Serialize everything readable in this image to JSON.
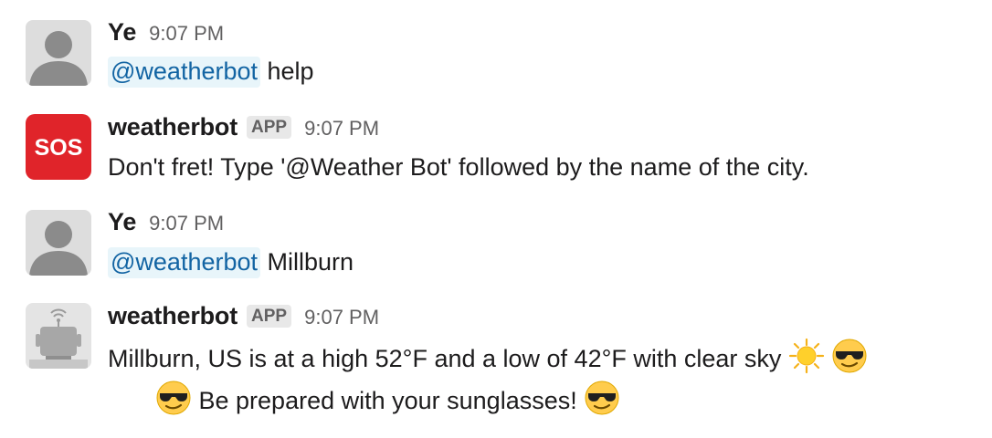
{
  "messages": [
    {
      "author": "Ye",
      "time": "9:07 PM",
      "mention": "@weatherbot",
      "text": " help",
      "avatar_icon": "user-silhouette-icon"
    },
    {
      "author": "weatherbot",
      "badge": "APP",
      "time": "9:07 PM",
      "text": "Don't fret! Type '@Weather Bot' followed by the name of the city.",
      "avatar_icon": "sos-icon"
    },
    {
      "author": "Ye",
      "time": "9:07 PM",
      "mention": "@weatherbot",
      "text": " Millburn",
      "avatar_icon": "user-silhouette-icon"
    },
    {
      "author": "weatherbot",
      "badge": "APP",
      "time": "9:07 PM",
      "text_line1": "Millburn, US is at a high 52°F and a low of 42°F with clear sky ",
      "text_line2": " Be prepared with your sunglasses! ",
      "avatar_icon": "robot-icon",
      "emojis": [
        "sun-emoji",
        "sunglasses-emoji",
        "sunglasses-emoji",
        "sunglasses-emoji"
      ]
    }
  ],
  "colors": {
    "mention_bg": "#e8f5fa",
    "mention_text": "#1264a3",
    "sos_red": "#e0242a",
    "timestamp": "#616061"
  }
}
